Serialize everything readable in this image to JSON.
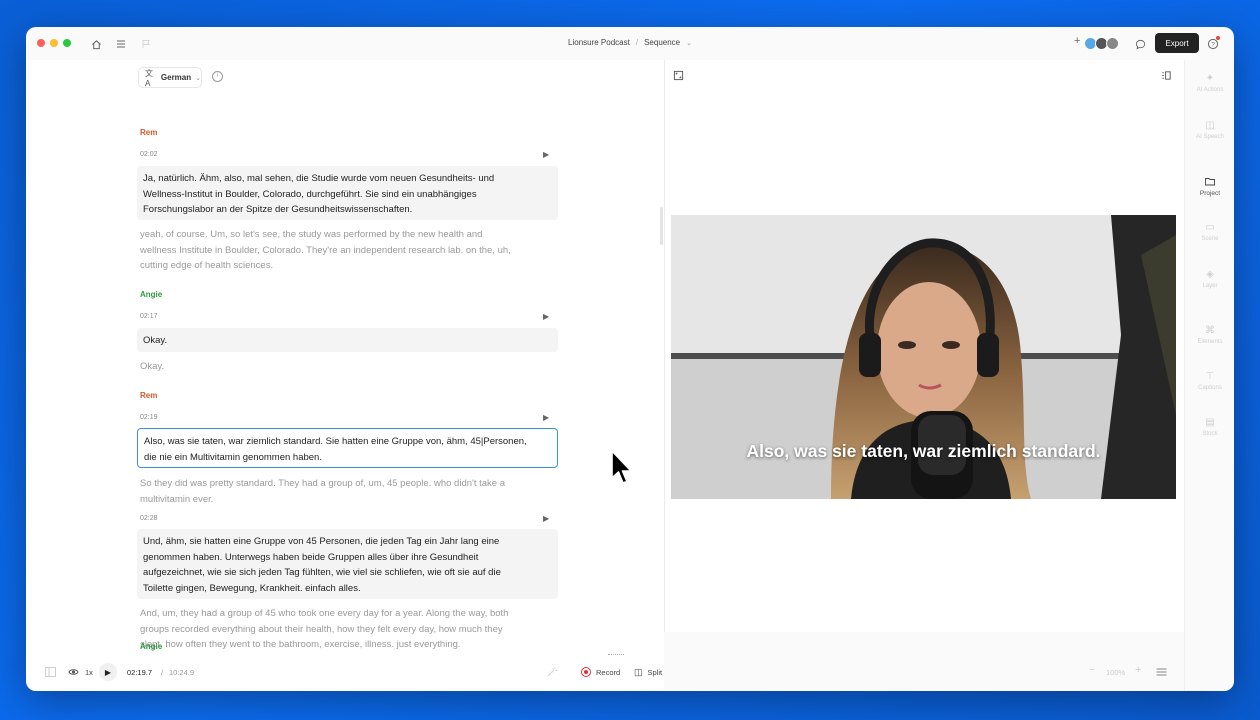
{
  "titlebar": {
    "project": "Lionsure Podcast",
    "separator": "/",
    "sequence": "Sequence",
    "export_label": "Export",
    "add_label": "+"
  },
  "language": {
    "label": "German"
  },
  "segments": [
    {
      "speaker": "Rem",
      "speaker_color": "#d8562d",
      "time": "02:02",
      "lines": [
        "Ja, natürlich. Ähm, also, mal sehen, die Studie wurde vom neuen Gesundheits- und",
        "Wellness-Institut in Boulder, Colorado, durchgeführt. Sie sind ein unabhängiges",
        "Forschungslabor an der Spitze der Gesundheitswissenschaften."
      ],
      "translation": [
        "yeah, of course. Um, so let's see, the study was performed by the new health and",
        "wellness Institute in Boulder, Colorado. They're an independent research lab. on the, uh,",
        "cutting edge of health sciences."
      ]
    },
    {
      "speaker": "Angie",
      "speaker_color": "#2e9a3e",
      "time": "02:17",
      "lines": [
        "Okay."
      ],
      "translation": [
        "Okay."
      ]
    },
    {
      "speaker": "Rem",
      "speaker_color": "#d8562d",
      "time": "02:19",
      "lines": [
        "Also, was sie taten, war ziemlich standard. Sie hatten eine Gruppe von, ähm, 45|Personen,",
        "die nie ein Multivitamin genommen haben."
      ],
      "translation": [
        "So they did was pretty standard. They had a group of, um, 45 people. who didn't take a",
        "multivitamin ever."
      ]
    },
    {
      "speaker": "",
      "speaker_color": "#d8562d",
      "time": "02:28",
      "lines": [
        "Und, ähm, sie hatten eine Gruppe von 45 Personen, die jeden Tag ein Jahr lang eine",
        "genommen haben. Unterwegs haben beide Gruppen alles über ihre Gesundheit",
        "aufgezeichnet, wie sie sich jeden Tag fühlten, wie viel sie schliefen, wie oft sie auf die",
        "Toilette gingen, Bewegung, Krankheit. einfach alles."
      ],
      "translation": [
        "And, um, they had a group of 45 who took one every day for a year. Along the way, both",
        "groups recorded everything about their health, how they felt every day, how much they",
        "slept, how often they went to the bathroom, exercise, illness. just everything."
      ]
    }
  ],
  "next_speaker": {
    "name": "Angie",
    "color": "#2e9a3e"
  },
  "video": {
    "caption": "Also, was sie taten, war ziemlich standard."
  },
  "sidebar": [
    {
      "label": "AI Actions",
      "icon": "sparkle-icon"
    },
    {
      "label": "AI Speech",
      "icon": "robot-icon"
    },
    {
      "label": "Project",
      "icon": "folder-icon"
    },
    {
      "label": "Scene",
      "icon": "scene-icon"
    },
    {
      "label": "Layer",
      "icon": "layers-icon"
    },
    {
      "label": "Elements",
      "icon": "shapes-icon"
    },
    {
      "label": "Captions",
      "icon": "captions-icon"
    },
    {
      "label": "Stock",
      "icon": "stock-icon"
    }
  ],
  "playback": {
    "speed": "1x",
    "current_time": "02:19.7",
    "separator": "/",
    "total_time": "10:24.9",
    "record_label": "Record",
    "split_label": "Split",
    "zoom": "100%"
  }
}
